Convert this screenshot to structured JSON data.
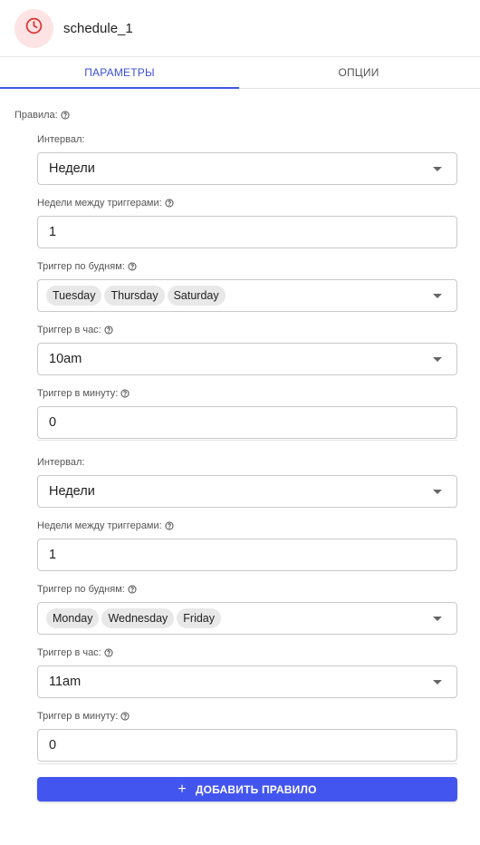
{
  "node": {
    "name": "schedule_1",
    "icon": "clock-icon",
    "accent": "#e03131"
  },
  "tabs": [
    {
      "label": "ПАРАМЕТРЫ",
      "active": true
    },
    {
      "label": "ОПЦИИ",
      "active": false
    }
  ],
  "rules_label": "Правила:",
  "rules": [
    {
      "interval": {
        "label": "Интервал:",
        "value": "Недели"
      },
      "weeks_between": {
        "label": "Недели между триггерами:",
        "value": "1"
      },
      "weekdays": {
        "label": "Триггер по будням:",
        "chips": [
          "Tuesday",
          "Thursday",
          "Saturday"
        ]
      },
      "hour": {
        "label": "Триггер в час:",
        "value": "10am"
      },
      "minute": {
        "label": "Триггер в минуту:",
        "value": "0"
      }
    },
    {
      "interval": {
        "label": "Интервал:",
        "value": "Недели"
      },
      "weeks_between": {
        "label": "Недели между триггерами:",
        "value": "1"
      },
      "weekdays": {
        "label": "Триггер по будням:",
        "chips": [
          "Monday",
          "Wednesday",
          "Friday"
        ]
      },
      "hour": {
        "label": "Триггер в час:",
        "value": "11am"
      },
      "minute": {
        "label": "Триггер в минуту:",
        "value": "0"
      }
    }
  ],
  "add_button": {
    "label": "ДОБАВИТЬ ПРАВИЛО",
    "color": "#4355ef"
  }
}
